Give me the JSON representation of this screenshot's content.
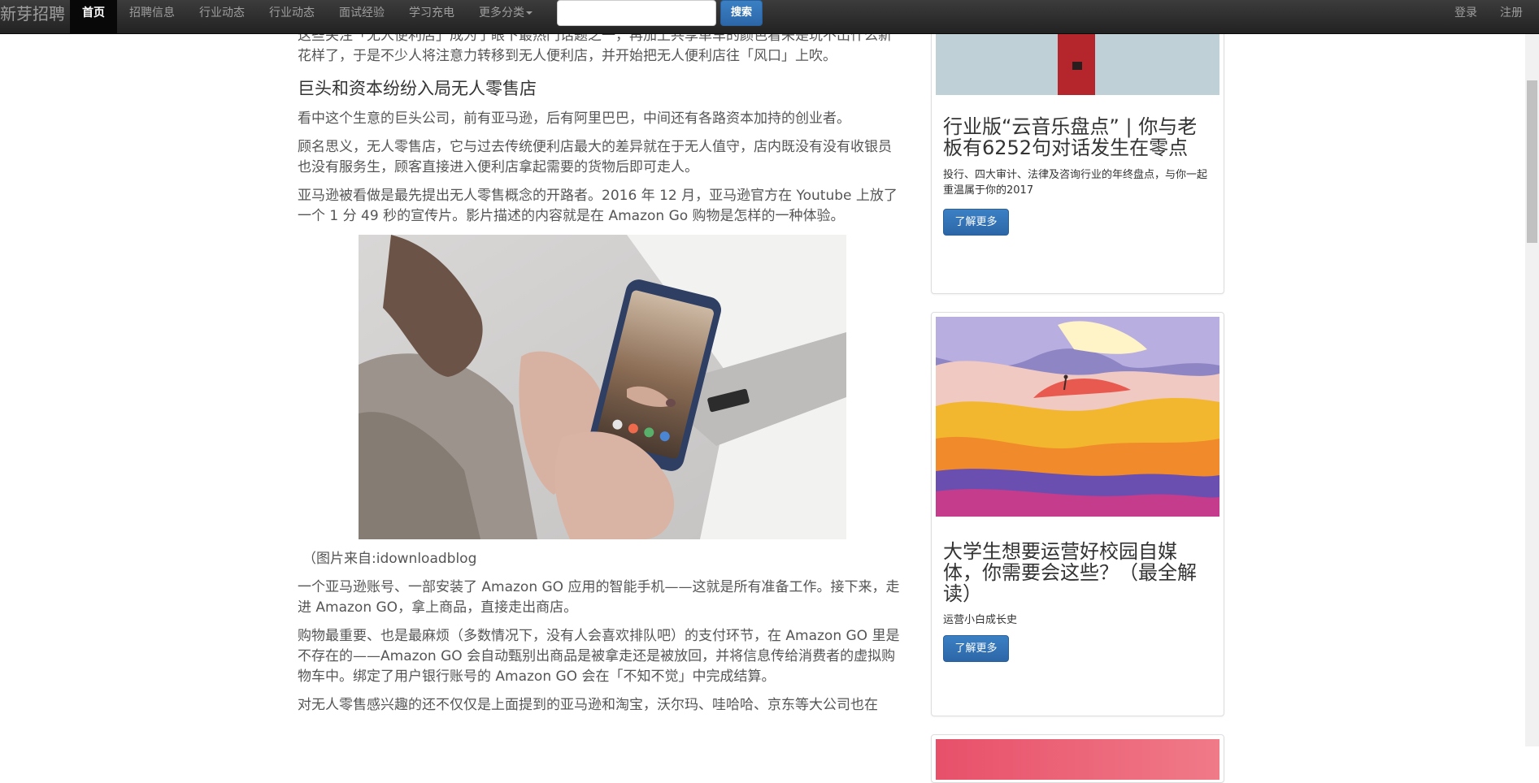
{
  "navbar": {
    "brand": "新芽招聘",
    "items": [
      "首页",
      "招聘信息",
      "行业动态",
      "行业动态",
      "面试经验",
      "学习充电",
      "更多分类"
    ],
    "search_placeholder": "",
    "search_button": "搜索",
    "login": "登录",
    "register": "注册"
  },
  "article": {
    "intro": "这些关注「无人便利店」成为了眼下最热门话题之一，再加上共享单车的颜色看来是玩不出什么新花样了，于是不少人将注意力转移到无人便利店，并开始把无人便利店往「风口」上吹。",
    "heading": "巨头和资本纷纷入局无人零售店",
    "p1": "看中这个生意的巨头公司，前有亚马逊，后有阿里巴巴，中间还有各路资本加持的创业者。",
    "p2": "顾名思义，无人零售店，它与过去传统便利店最大的差异就在于无人值守，店内既没有没有收银员也没有服务生，顾客直接进入便利店拿起需要的货物后即可走人。",
    "p3": "亚马逊被看做是最先提出无人零售概念的开路者。2016 年 12 月，亚马逊官方在 Youtube 上放了一个 1 分 49 秒的宣传片。影片描述的内容就是在 Amazon Go 购物是怎样的一种体验。",
    "caption": "（图片来自:idownloadblog",
    "p4": "一个亚马逊账号、一部安装了 Amazon GO 应用的智能手机——这就是所有准备工作。接下来，走进 Amazon GO，拿上商品，直接走出商店。",
    "p5": "购物最重要、也是最麻烦（多数情况下，没有人会喜欢排队吧）的支付环节，在 Amazon GO 里是不存在的——Amazon GO 会自动甄别出商品是被拿走还是被放回，并将信息传给消费者的虚拟购物车中。绑定了用户银行账号的 Amazon GO 会在「不知不觉」中完成结算。",
    "p6": "对无人零售感兴趣的还不仅仅是上面提到的亚马逊和淘宝，沃尔玛、哇哈哈、京东等大公司也在"
  },
  "sidebar": {
    "cards": [
      {
        "title": "行业版“云音乐盘点” | 你与老板有6252句对话发生在零点",
        "desc": "投行、四大审计、法律及咨询行业的年终盘点，与你一起重温属于你的2017",
        "button": "了解更多"
      },
      {
        "title": "大学生想要运营好校园自媒体，你需要会这些？（最全解读）",
        "desc": "运营小白成长史",
        "button": "了解更多"
      }
    ]
  },
  "colors": {
    "navbar_bg": "#222222",
    "primary_button": "#337ab7"
  }
}
